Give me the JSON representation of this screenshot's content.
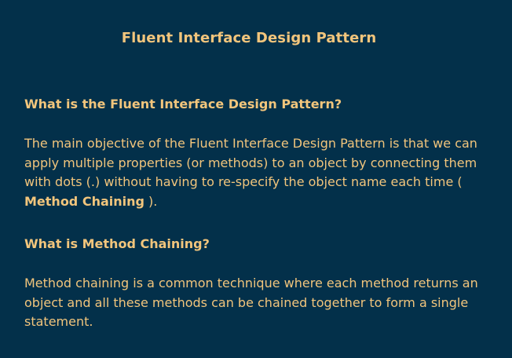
{
  "slide": {
    "title": "Fluent Interface Design Pattern",
    "sections": [
      {
        "heading": "What is the Fluent Interface Design Pattern?",
        "paragraph_prefix": "The main objective of the Fluent Interface Design Pattern is that we can apply multiple properties (or methods) to an object by connecting them with dots (.) without having to re-specify the object name each time ( ",
        "paragraph_emphasis": "Method Chaining",
        "paragraph_suffix": " )."
      },
      {
        "heading": "What is Method Chaining?",
        "paragraph": "Method chaining is a common technique where each method returns an object and all these methods can be chained together to form a single statement."
      }
    ]
  },
  "colors": {
    "background": "#03304a",
    "text": "#f2c57c"
  }
}
